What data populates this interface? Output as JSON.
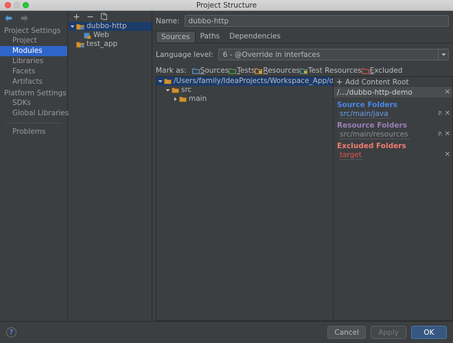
{
  "window": {
    "title": "Project Structure",
    "traffic_lights": [
      "close-red",
      "minimize-disabled",
      "zoom-green"
    ]
  },
  "sidebar": {
    "back_icon": "arrow-left-icon",
    "forward_icon": "arrow-right-icon",
    "groups": [
      {
        "label": "Project Settings",
        "items": [
          {
            "label": "Project",
            "selected": false
          },
          {
            "label": "Modules",
            "selected": true
          },
          {
            "label": "Libraries",
            "selected": false
          },
          {
            "label": "Facets",
            "selected": false
          },
          {
            "label": "Artifacts",
            "selected": false
          }
        ]
      },
      {
        "label": "Platform Settings",
        "items": [
          {
            "label": "SDKs",
            "selected": false
          },
          {
            "label": "Global Libraries",
            "selected": false
          }
        ]
      }
    ],
    "problems_label": "Problems"
  },
  "modules": {
    "toolbar": {
      "add": "+",
      "remove": "−",
      "copy": "copy-icon"
    },
    "tree": [
      {
        "label": "dubbo-http",
        "icon": "module-folder-icon",
        "expanded": true,
        "selected": true,
        "depth": 0
      },
      {
        "label": "Web",
        "icon": "web-facet-icon",
        "expanded": null,
        "selected": false,
        "depth": 1
      },
      {
        "label": "test_app",
        "icon": "module-folder-icon",
        "expanded": null,
        "selected": false,
        "depth": 0
      }
    ]
  },
  "editor": {
    "name_label": "Name:",
    "name_value": "dubbo-http",
    "name_placeholder": "",
    "tabs": [
      {
        "label": "Sources",
        "active": true
      },
      {
        "label": "Paths",
        "active": false
      },
      {
        "label": "Dependencies",
        "active": false
      }
    ],
    "language_level_label": "Language level:",
    "language_level_value": "6 - @Override in interfaces",
    "mark_as_label": "Mark as:",
    "mark_as_buttons": [
      {
        "label": "Sources",
        "mnemonic": "S",
        "color": "#5c9fd6"
      },
      {
        "label": "Tests",
        "mnemonic": "T",
        "color": "#5aa84f"
      },
      {
        "label": "Resources",
        "mnemonic": "R",
        "color": "#d5a03a"
      },
      {
        "label": "Test Resources",
        "mnemonic": "",
        "color": "#4f9f96"
      },
      {
        "label": "Excluded",
        "mnemonic": "E",
        "color": "#e0564a"
      }
    ]
  },
  "content_tree": [
    {
      "label": "/Users/family/IdeaProjects/Workspace_App/dubbo-http-demo",
      "depth": 0,
      "expanded": true,
      "selected": true,
      "icon": "folder-icon"
    },
    {
      "label": "src",
      "depth": 1,
      "expanded": true,
      "selected": false,
      "icon": "folder-icon"
    },
    {
      "label": "main",
      "depth": 2,
      "expanded": false,
      "selected": false,
      "icon": "folder-icon"
    }
  ],
  "content_roots": {
    "add_label": "Add Content Root",
    "add_icon": "plus-icon",
    "root_path": "/…/dubbo-http-demo",
    "root_close_icon": "close-icon",
    "groups": [
      {
        "title": "Source Folders",
        "kind": "src",
        "title_color": "#4a86e8",
        "folders": [
          {
            "path": "src/main/java",
            "has_package_prefix": true,
            "close_icon": "close-icon"
          }
        ]
      },
      {
        "title": "Resource Folders",
        "kind": "res",
        "title_color": "#9a7fb8",
        "folders": [
          {
            "path": "src/main/resources",
            "has_package_prefix": true,
            "close_icon": "close-icon"
          }
        ]
      },
      {
        "title": "Excluded Folders",
        "kind": "exc",
        "title_color": "#f07c6e",
        "folders": [
          {
            "path": "target",
            "has_package_prefix": false,
            "close_icon": "close-icon"
          }
        ]
      }
    ]
  },
  "footer": {
    "help_label": "?",
    "cancel_label": "Cancel",
    "apply_label": "Apply",
    "ok_label": "OK"
  }
}
